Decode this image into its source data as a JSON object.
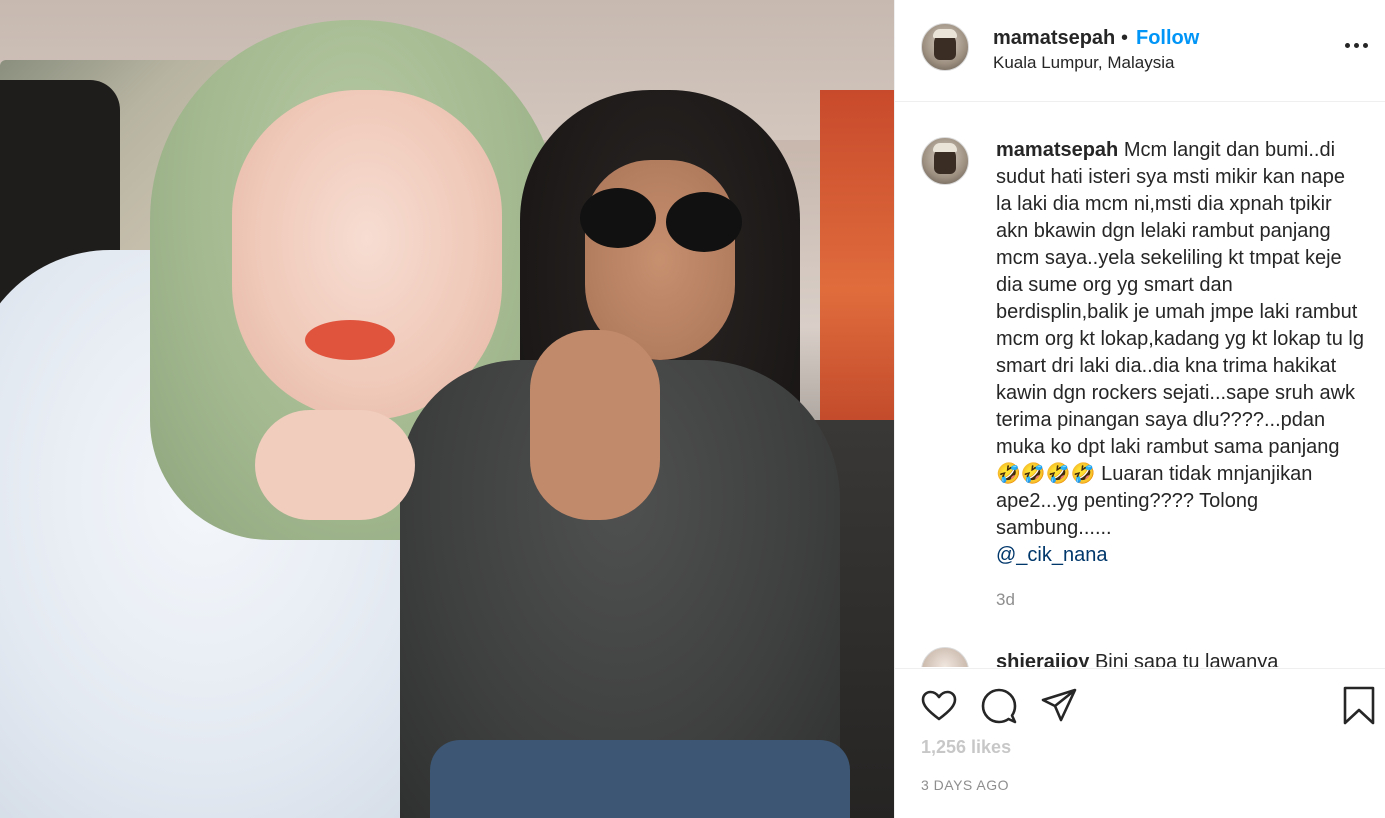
{
  "header": {
    "username": "mamatsepah",
    "separator": "•",
    "follow_label": "Follow",
    "location": "Kuala Lumpur, Malaysia"
  },
  "caption": {
    "username": "mamatsepah",
    "text": "Mcm langit dan bumi..di sudut hati isteri sya msti mikir kan nape la laki dia mcm ni,msti dia xpnah tpikir akn bkawin dgn lelaki rambut panjang mcm saya..yela sekeliling kt tmpat keje dia sume org yg smart dan berdisplin,balik je umah jmpe laki rambut mcm org kt lokap,kadang yg kt lokap tu lg smart dri laki dia..dia kna trima hakikat kawin dgn rockers sejati...sape sruh awk terima pinangan saya dlu????...pdan muka ko dpt laki rambut sama panjang 🤣🤣🤣🤣 Luaran tidak mnjanjikan ape2...yg penting???? Tolong sambung......",
    "mention": "@_cik_nana",
    "time_ago": "3d"
  },
  "comment2": {
    "username": "shierajjoy",
    "text": "Bini sapa tu lawanya"
  },
  "actions": {
    "likes_text": "1,256 likes",
    "date": "3 DAYS AGO"
  },
  "icons": [
    "heart-icon",
    "comment-icon",
    "share-icon",
    "bookmark-icon",
    "more-options-icon"
  ],
  "colors": {
    "follow": "#0095f6",
    "text": "#262626",
    "muted": "#8e8e8e",
    "mention": "#00376b"
  }
}
